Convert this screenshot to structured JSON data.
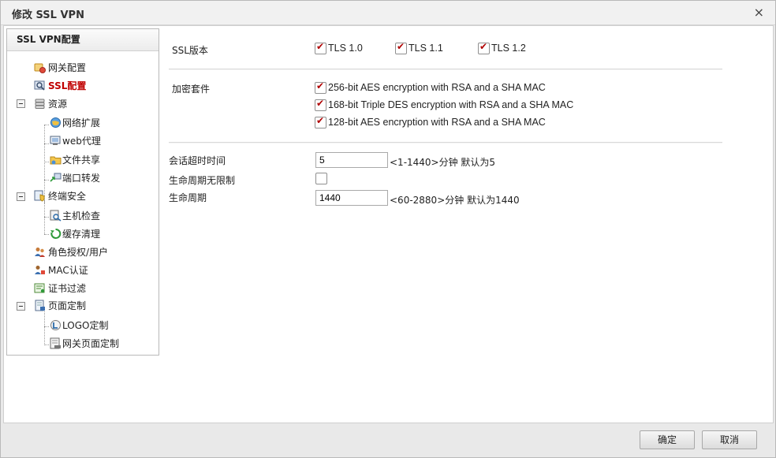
{
  "dialog": {
    "title": "修改 SSL VPN",
    "close_glyph": "×"
  },
  "tree": {
    "header": "SSL VPN配置",
    "items": [
      {
        "label": "网关配置",
        "icon": "gateway-config-icon"
      },
      {
        "label": "SSL配置",
        "icon": "ssl-config-icon",
        "selected": true
      },
      {
        "label": "资源",
        "icon": "database-icon",
        "expanded": true
      },
      {
        "label": "网络扩展",
        "icon": "network-extension-icon"
      },
      {
        "label": "web代理",
        "icon": "web-proxy-icon"
      },
      {
        "label": "文件共享",
        "icon": "folder-share-icon"
      },
      {
        "label": "端口转发",
        "icon": "port-forward-icon"
      },
      {
        "label": "终端安全",
        "icon": "terminal-security-icon",
        "expanded": true
      },
      {
        "label": "主机检查",
        "icon": "host-check-icon"
      },
      {
        "label": "缓存清理",
        "icon": "cache-clean-icon"
      },
      {
        "label": "角色授权/用户",
        "icon": "role-user-icon"
      },
      {
        "label": "MAC认证",
        "icon": "mac-auth-icon"
      },
      {
        "label": "证书过滤",
        "icon": "certificate-filter-icon"
      },
      {
        "label": "页面定制",
        "icon": "page-custom-icon",
        "expanded": true
      },
      {
        "label": "LOGO定制",
        "icon": "logo-custom-icon"
      },
      {
        "label": "网关页面定制",
        "icon": "gateway-page-icon"
      }
    ]
  },
  "form": {
    "ssl_version": {
      "label": "SSL版本",
      "options": [
        {
          "label": "TLS 1.0",
          "checked": true
        },
        {
          "label": "TLS 1.1",
          "checked": true
        },
        {
          "label": "TLS 1.2",
          "checked": true
        }
      ]
    },
    "cipher_suite": {
      "label": "加密套件",
      "options": [
        {
          "label": "256-bit AES encryption with RSA and a SHA MAC",
          "checked": true
        },
        {
          "label": "168-bit Triple DES encryption with RSA and a SHA MAC",
          "checked": true
        },
        {
          "label": "128-bit AES encryption with RSA and a SHA MAC",
          "checked": true
        }
      ]
    },
    "session_timeout": {
      "label": "会话超时时间",
      "value": "5",
      "hint": "<1-1440>分钟 默认为5"
    },
    "lifetime_unlimited": {
      "label": "生命周期无限制",
      "checked": false
    },
    "lifetime": {
      "label": "生命周期",
      "value": "1440",
      "hint": "<60-2880>分钟 默认为1440"
    }
  },
  "buttons": {
    "ok": "确定",
    "cancel": "取消"
  },
  "colors": {
    "selected_text": "#c00000",
    "check_mark": "#b00000"
  }
}
